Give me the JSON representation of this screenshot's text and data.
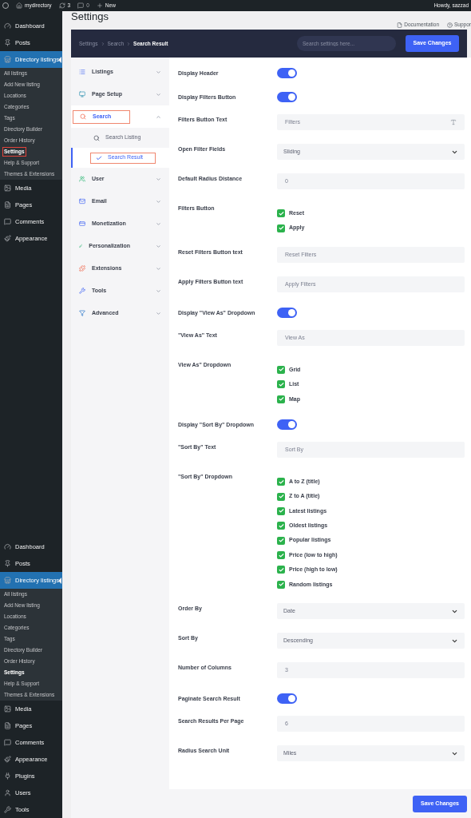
{
  "admin_bar": {
    "site": "mydirectory",
    "updates": "3",
    "comments": "0",
    "new": "New",
    "greeting": "Howdy, sazzad"
  },
  "admin_menu_top": [
    {
      "label": "Dashboard",
      "kind": "top",
      "selected": false,
      "outlined": false
    },
    {
      "label": "Posts",
      "kind": "top",
      "selected": false,
      "outlined": false
    },
    {
      "label": "Directory listings",
      "kind": "top",
      "selected": true,
      "outlined": false
    },
    {
      "label": "All listings",
      "kind": "sub",
      "selected": false,
      "outlined": false
    },
    {
      "label": "Add New listing",
      "kind": "sub",
      "selected": false,
      "outlined": false
    },
    {
      "label": "Locations",
      "kind": "sub",
      "selected": false,
      "outlined": false
    },
    {
      "label": "Categories",
      "kind": "sub",
      "selected": false,
      "outlined": false
    },
    {
      "label": "Tags",
      "kind": "sub",
      "selected": false,
      "outlined": false
    },
    {
      "label": "Directory Builder",
      "kind": "sub",
      "selected": false,
      "outlined": false
    },
    {
      "label": "Order History",
      "kind": "sub",
      "selected": false,
      "outlined": false
    },
    {
      "label": "Settings",
      "kind": "sub",
      "selected": true,
      "outlined": true
    },
    {
      "label": "Help & Support",
      "kind": "sub",
      "selected": false,
      "outlined": false
    },
    {
      "label": "Themes & Extensions",
      "kind": "sub",
      "selected": false,
      "outlined": false
    },
    {
      "label": "Media",
      "kind": "top",
      "selected": false,
      "outlined": false
    },
    {
      "label": "Pages",
      "kind": "top",
      "selected": false,
      "outlined": false
    },
    {
      "label": "Comments",
      "kind": "top",
      "selected": false,
      "outlined": false
    },
    {
      "label": "Appearance",
      "kind": "top",
      "selected": false,
      "outlined": false
    }
  ],
  "admin_menu_bottom": [
    {
      "label": "Dashboard",
      "kind": "top",
      "selected": false,
      "outlined": false
    },
    {
      "label": "Posts",
      "kind": "top",
      "selected": false,
      "outlined": false
    },
    {
      "label": "Directory listings",
      "kind": "top",
      "selected": true,
      "outlined": false
    },
    {
      "label": "All listings",
      "kind": "sub",
      "selected": false,
      "outlined": false
    },
    {
      "label": "Add New listing",
      "kind": "sub",
      "selected": false,
      "outlined": false
    },
    {
      "label": "Locations",
      "kind": "sub",
      "selected": false,
      "outlined": false
    },
    {
      "label": "Categories",
      "kind": "sub",
      "selected": false,
      "outlined": false
    },
    {
      "label": "Tags",
      "kind": "sub",
      "selected": false,
      "outlined": false
    },
    {
      "label": "Directory Builder",
      "kind": "sub",
      "selected": false,
      "outlined": false
    },
    {
      "label": "Order History",
      "kind": "sub",
      "selected": false,
      "outlined": false
    },
    {
      "label": "Settings",
      "kind": "sub",
      "selected": true,
      "outlined": false
    },
    {
      "label": "Help & Support",
      "kind": "sub",
      "selected": false,
      "outlined": false
    },
    {
      "label": "Themes & Extensions",
      "kind": "sub",
      "selected": false,
      "outlined": false
    },
    {
      "label": "Media",
      "kind": "top",
      "selected": false,
      "outlined": false
    },
    {
      "label": "Pages",
      "kind": "top",
      "selected": false,
      "outlined": false
    },
    {
      "label": "Comments",
      "kind": "top",
      "selected": false,
      "outlined": false
    },
    {
      "label": "Appearance",
      "kind": "top",
      "selected": false,
      "outlined": false
    },
    {
      "label": "Plugins",
      "kind": "top",
      "selected": false,
      "outlined": false
    },
    {
      "label": "Users",
      "kind": "top",
      "selected": false,
      "outlined": false
    },
    {
      "label": "Tools",
      "kind": "top",
      "selected": false,
      "outlined": false
    }
  ],
  "page": {
    "title": "Settings",
    "links": [
      "Documentation",
      "Suppor"
    ]
  },
  "header": {
    "breadcrumb": [
      "Settings",
      "Search",
      "Search Result"
    ],
    "search_placeholder": "Search settings here...",
    "save": "Save Changes"
  },
  "nav": [
    {
      "label": "Listings",
      "expanded": false,
      "selected": false,
      "outlined": false
    },
    {
      "label": "Page Setup",
      "expanded": false,
      "selected": false,
      "outlined": false
    },
    {
      "label": "Search",
      "expanded": true,
      "selected": true,
      "outlined": true,
      "children": [
        {
          "label": "Search Listing",
          "selected": false,
          "outlined": false
        },
        {
          "label": "Search Result",
          "selected": true,
          "outlined": true
        }
      ]
    },
    {
      "label": "User",
      "expanded": false,
      "selected": false,
      "outlined": false
    },
    {
      "label": "Email",
      "expanded": false,
      "selected": false,
      "outlined": false
    },
    {
      "label": "Monetization",
      "expanded": false,
      "selected": false,
      "outlined": false
    },
    {
      "label": "Personalization",
      "expanded": false,
      "selected": false,
      "outlined": false
    },
    {
      "label": "Extensions",
      "expanded": false,
      "selected": false,
      "outlined": false
    },
    {
      "label": "Tools",
      "expanded": false,
      "selected": false,
      "outlined": false
    },
    {
      "label": "Advanced",
      "expanded": false,
      "selected": false,
      "outlined": false
    }
  ],
  "fields": [
    {
      "label": "Display Header",
      "kind": "toggle",
      "on": true
    },
    {
      "label": "Display Filters Button",
      "kind": "toggle",
      "on": true
    },
    {
      "label": "Filters Button Text",
      "kind": "text",
      "value": "Filters",
      "format_icon": true
    },
    {
      "label": "Open Filter Fields",
      "kind": "select",
      "value": "Sliding"
    },
    {
      "label": "Default Radius Distance",
      "kind": "text",
      "value": "0"
    },
    {
      "label": "Filters Button",
      "kind": "checks",
      "options": [
        {
          "label": "Reset",
          "checked": true
        },
        {
          "label": "Apply",
          "checked": true
        }
      ]
    },
    {
      "label": "Reset Filters Button text",
      "kind": "text",
      "value": "Reset Filters"
    },
    {
      "label": "Apply Filters Button text",
      "kind": "text",
      "value": "Apply Filters"
    },
    {
      "label": "Display \"View As\" Dropdown",
      "kind": "toggle",
      "on": true
    },
    {
      "label": "\"View As\" Text",
      "kind": "text",
      "value": "View As"
    },
    {
      "label": "View As\" Dropdown",
      "kind": "checks",
      "options": [
        {
          "label": "Grid",
          "checked": true
        },
        {
          "label": "List",
          "checked": true
        },
        {
          "label": "Map",
          "checked": true
        }
      ]
    },
    {
      "label": "Display \"Sort By\" Dropdown",
      "kind": "toggle",
      "on": true
    },
    {
      "label": "\"Sort By\" Text",
      "kind": "text",
      "value": "Sort By"
    },
    {
      "label": "\"Sort By\" Dropdown",
      "kind": "checks",
      "options": [
        {
          "label": "A to Z (title)",
          "checked": true
        },
        {
          "label": "Z to A (title)",
          "checked": true
        },
        {
          "label": "Latest listings",
          "checked": true
        },
        {
          "label": "Oldest listings",
          "checked": true
        },
        {
          "label": "Popular listings",
          "checked": true
        },
        {
          "label": "Price (low to high)",
          "checked": true
        },
        {
          "label": "Price (high to low)",
          "checked": true
        },
        {
          "label": "Random listings",
          "checked": true
        }
      ]
    },
    {
      "label": "Order By",
      "kind": "select",
      "value": "Date"
    },
    {
      "label": "Sort By",
      "kind": "select",
      "value": "Descending"
    },
    {
      "label": "Number of Columns",
      "kind": "text",
      "value": "3"
    },
    {
      "label": "Paginate Search Result",
      "kind": "toggle",
      "on": true
    },
    {
      "label": "Search Results Per Page",
      "kind": "text",
      "value": "6"
    },
    {
      "label": "Radius Search Unit",
      "kind": "select",
      "value": "Miles"
    }
  ],
  "footer": {
    "save": "Save Changes"
  }
}
